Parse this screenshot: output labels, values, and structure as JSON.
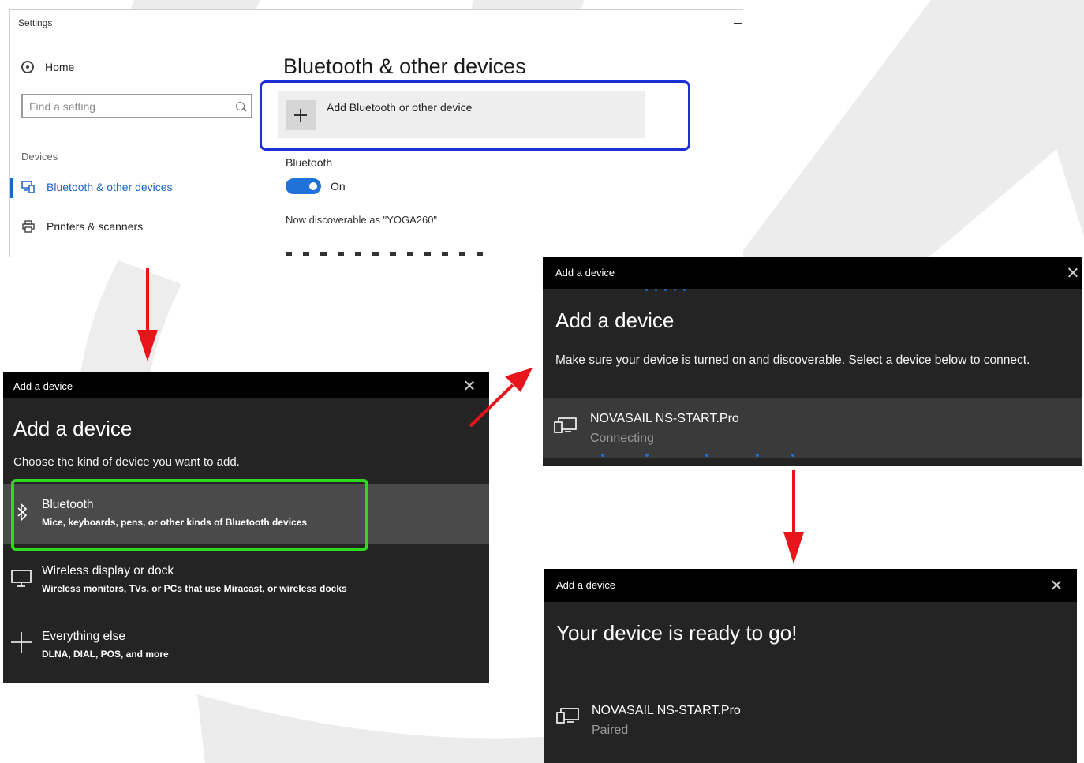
{
  "settings": {
    "window_title": "Settings",
    "home_label": "Home",
    "search_placeholder": "Find a setting",
    "section_label": "Devices",
    "nav": [
      {
        "label": "Bluetooth & other devices",
        "icon": "bluetooth-devices-icon",
        "selected": true
      },
      {
        "label": "Printers & scanners",
        "icon": "printer-icon",
        "selected": false
      }
    ],
    "page_title": "Bluetooth & other devices",
    "add_button_label": "Add Bluetooth or other device",
    "bluetooth_heading": "Bluetooth",
    "toggle_state": "On",
    "discoverable_text": "Now discoverable as \"YOGA260\"",
    "accent_color": "#1e63c4"
  },
  "dialog_choose": {
    "window_title": "Add a device",
    "heading": "Add a device",
    "instruction": "Choose the kind of device you want to add.",
    "options": [
      {
        "title": "Bluetooth",
        "desc": "Mice, keyboards, pens, or other kinds of Bluetooth devices",
        "icon": "bluetooth-icon",
        "selected": true
      },
      {
        "title": "Wireless display or dock",
        "desc": "Wireless monitors, TVs, or PCs that use Miracast, or wireless docks",
        "icon": "monitor-icon",
        "selected": false
      },
      {
        "title": "Everything else",
        "desc": "DLNA, DIAL, POS, and more",
        "icon": "plus-icon",
        "selected": false
      }
    ],
    "highlight_color": "#2fd81d"
  },
  "dialog_connecting": {
    "window_title": "Add a device",
    "heading": "Add a device",
    "instruction": "Make sure your device is turned on and discoverable. Select a device below to connect.",
    "device_name": "NOVASAIL NS-START.Pro",
    "device_status": "Connecting"
  },
  "dialog_ready": {
    "window_title": "Add a device",
    "heading": "Your device is ready to go!",
    "device_name": "NOVASAIL NS-START.Pro",
    "device_status": "Paired"
  },
  "annotation_colors": {
    "box": "#1c2fd6",
    "arrow": "#e8141b"
  }
}
